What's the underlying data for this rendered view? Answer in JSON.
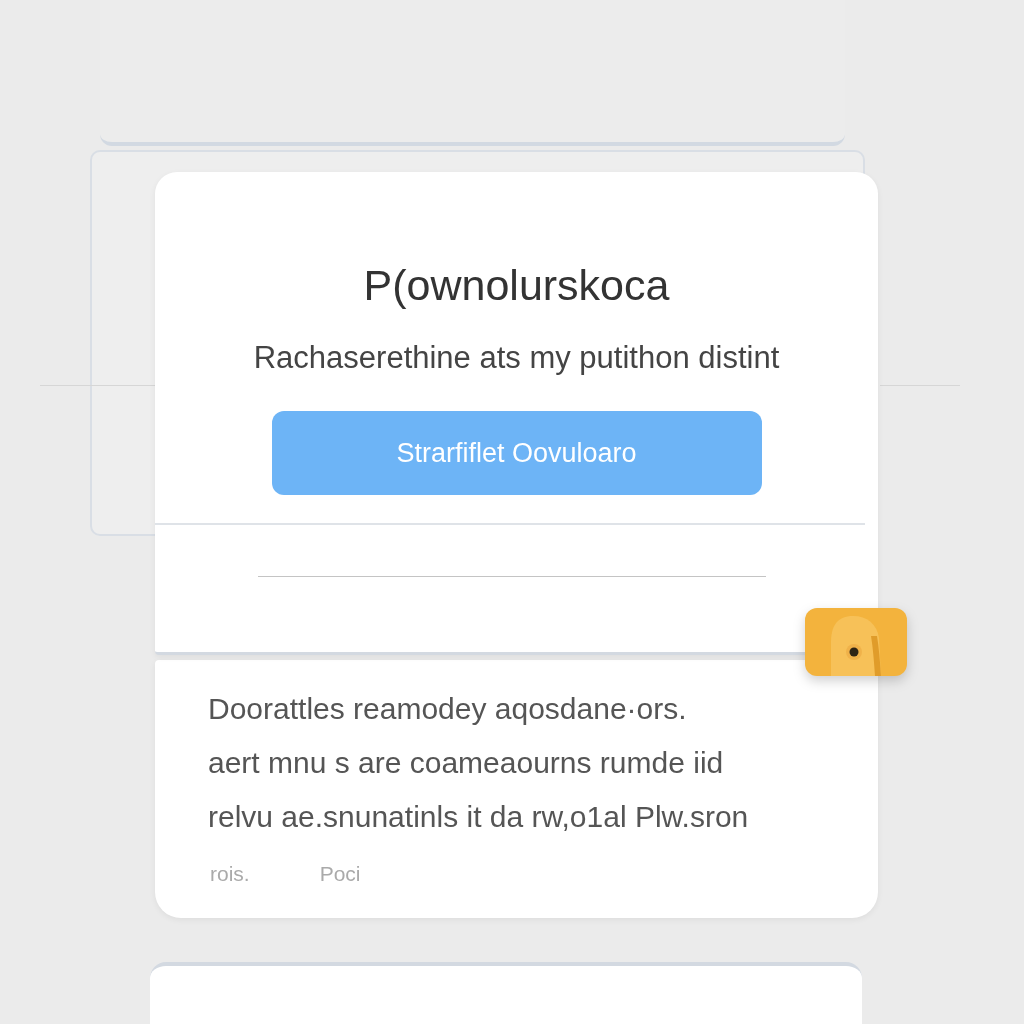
{
  "title": "P(ownolurskoca",
  "subtitle": "Rachaserethine ats my putithon distint",
  "button": {
    "label": "Strarfiflet Oovuloaro"
  },
  "description": {
    "lines": [
      "Doorattles reamodey aqosdane·ors.",
      "aert mnu s are coameaourns rumde iid",
      "relvu ae.snunatinls it da rw,o1al Plw.sron"
    ]
  },
  "footer": [
    "rois.",
    "Poci"
  ]
}
